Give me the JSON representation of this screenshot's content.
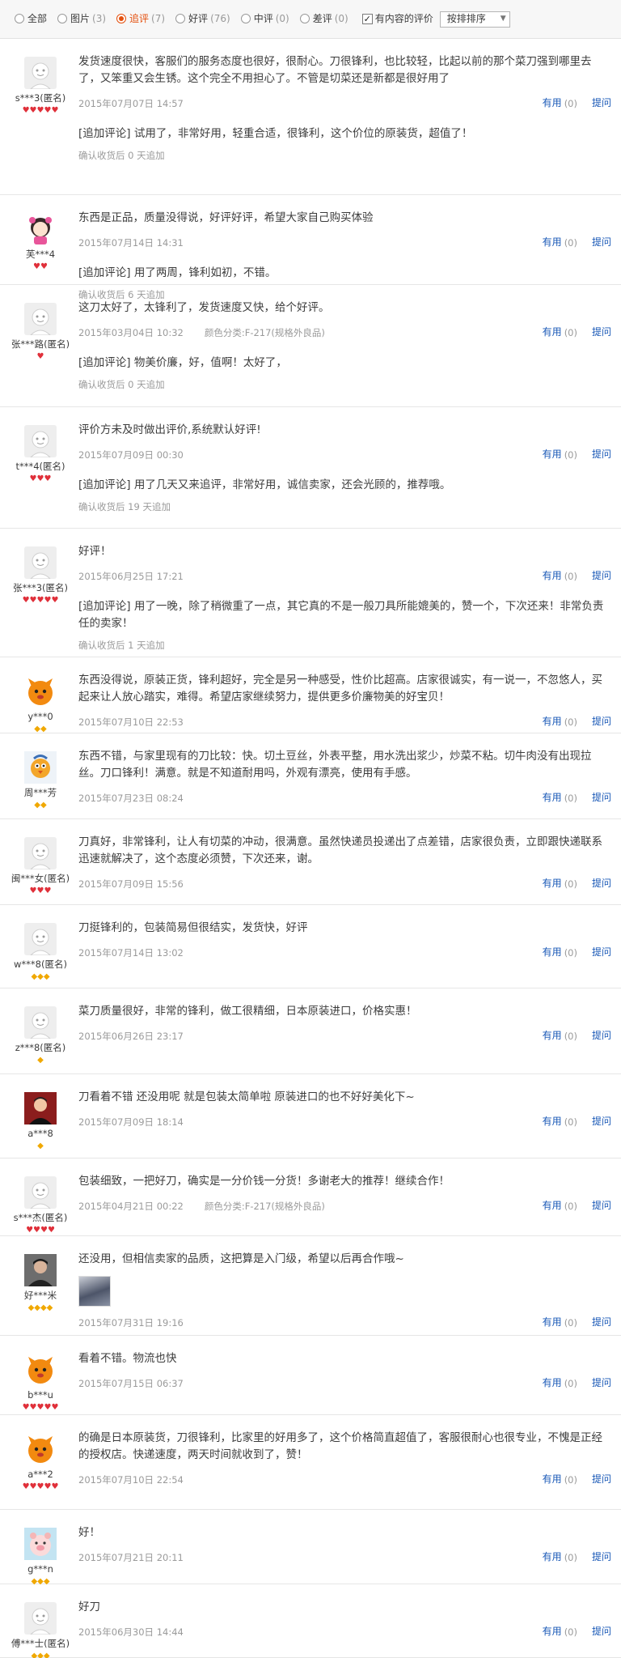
{
  "filter": {
    "options": [
      {
        "label": "全部",
        "count": ""
      },
      {
        "label": "图片",
        "count": "(3)"
      },
      {
        "label": "追评",
        "count": "(7)"
      },
      {
        "label": "好评",
        "count": "(76)"
      },
      {
        "label": "中评",
        "count": "(0)"
      },
      {
        "label": "差评",
        "count": "(0)"
      }
    ],
    "has_content_label": "有内容的评价",
    "sort_label": "按排排序"
  },
  "reviews": [
    {
      "user": "s***3(匿名)",
      "rank": "♥♥♥♥♥",
      "content": "发货速度很快，客服们的服务态度也很好，很耐心。刀很锋利，也比较轻，比起以前的那个菜刀强到哪里去了，又笨重又会生锈。这个完全不用担心了。不管是切菜还是新都是很好用了",
      "date": "2015年07月07日 14:57",
      "sku": "",
      "useful": "有用",
      "count": "(0)",
      "reply": "提问",
      "append": "[追加评论] 试用了，非常好用，轻重合适，很锋利，这个价位的原装货，超值了！",
      "confirm": "确认收货后 0 天追加"
    },
    {
      "user": "芙***4",
      "rank": "♥♥",
      "content": "东西是正品，质量没得说，好评好评，希望大家自己购买体验",
      "date": "2015年07月14日 14:31",
      "sku": "",
      "useful": "有用",
      "count": "(0)",
      "reply": "提问",
      "append": "[追加评论] 用了两周，锋利如初，不错。",
      "confirm": "确认收货后 6 天追加"
    },
    {
      "user": "张***路(匿名)",
      "rank": "♥",
      "content": "这刀太好了，太锋利了，发货速度又快，给个好评。",
      "date": "2015年03月04日 10:32",
      "sku": "颜色分类:F-217(规格外良品)",
      "useful": "有用",
      "count": "(0)",
      "reply": "提问",
      "append": "[追加评论] 物美价廉，好，值啊！太好了，",
      "confirm": "确认收货后 0 天追加"
    },
    {
      "user": "t***4(匿名)",
      "rank": "♥♥♥",
      "content": "评价方未及时做出评价,系统默认好评!",
      "date": "2015年07月09日 00:30",
      "sku": "",
      "useful": "有用",
      "count": "(0)",
      "reply": "提问",
      "append": "[追加评论] 用了几天又来追评，非常好用，诚信卖家，还会光顾的，推荐哦。",
      "confirm": "确认收货后 19 天追加"
    },
    {
      "user": "张***3(匿名)",
      "rank": "♥♥♥♥♥",
      "content": "好评！",
      "date": "2015年06月25日 17:21",
      "sku": "",
      "useful": "有用",
      "count": "(0)",
      "reply": "提问",
      "append": "[追加评论] 用了一晚，除了稍微重了一点，其它真的不是一般刀具所能媲美的，赞一个，下次还来！非常负责任的卖家！",
      "confirm": "确认收货后 1 天追加"
    },
    {
      "user": "y***0",
      "rank": "◆◆",
      "content": "东西没得说，原装正货，锋利超好，完全是另一种感受，性价比超高。店家很诚实，有一说一，不忽悠人，买起来让人放心踏实，难得。希望店家继续努力，提供更多价廉物美的好宝贝！",
      "date": "2015年07月10日 22:53",
      "sku": "",
      "useful": "有用",
      "count": "(0)",
      "reply": "提问",
      "append": "",
      "confirm": ""
    },
    {
      "user": "周***芳",
      "rank": "◆◆",
      "content": "东西不错，与家里现有的刀比较：快。切土豆丝，外表平整，用水洗出浆少，炒菜不粘。切牛肉没有出现拉丝。刀口锋利！满意。就是不知道耐用吗，外观有漂亮，使用有手感。",
      "date": "2015年07月23日 08:24",
      "sku": "",
      "useful": "有用",
      "count": "(0)",
      "reply": "提问",
      "append": "",
      "confirm": ""
    },
    {
      "user": "闽***女(匿名)",
      "rank": "♥♥♥",
      "content": "刀真好，非常锋利，让人有切菜的冲动，很满意。虽然快递员投递出了点差错，店家很负责，立即跟快递联系迅速就解决了，这个态度必须赞，下次还来，谢。",
      "date": "2015年07月09日 15:56",
      "sku": "",
      "useful": "有用",
      "count": "(0)",
      "reply": "提问",
      "append": "",
      "confirm": ""
    },
    {
      "user": "w***8(匿名)",
      "rank": "◆◆◆",
      "content": "刀挺锋利的，包装简易但很结实，发货快，好评",
      "date": "2015年07月14日 13:02",
      "sku": "",
      "useful": "有用",
      "count": "(0)",
      "reply": "提问",
      "append": "",
      "confirm": ""
    },
    {
      "user": "z***8(匿名)",
      "rank": "◆",
      "content": "菜刀质量很好，非常的锋利，做工很精细，日本原装进口，价格实惠！",
      "date": "2015年06月26日 23:17",
      "sku": "",
      "useful": "有用",
      "count": "(0)",
      "reply": "提问",
      "append": "",
      "confirm": ""
    },
    {
      "user": "a***8",
      "rank": "◆",
      "content": "刀看着不错 还没用呢 就是包装太简单啦 原装进口的也不好好美化下~",
      "date": "2015年07月09日 18:14",
      "sku": "",
      "useful": "有用",
      "count": "(0)",
      "reply": "提问",
      "append": "",
      "confirm": ""
    },
    {
      "user": "s***杰(匿名)",
      "rank": "♥♥♥♥",
      "content": "包装细致，一把好刀，确实是一分价钱一分货！多谢老大的推荐！继续合作！",
      "date": "2015年04月21日 00:22",
      "sku": "颜色分类:F-217(规格外良品)",
      "useful": "有用",
      "count": "(0)",
      "reply": "提问",
      "append": "",
      "confirm": ""
    },
    {
      "user": "好***米",
      "rank": "◆◆◆◆",
      "content": "还没用，但相信卖家的品质，这把算是入门级，希望以后再合作哦~",
      "date": "2015年07月31日 19:16",
      "sku": "",
      "useful": "有用",
      "count": "(0)",
      "reply": "提问",
      "append": "",
      "confirm": ""
    },
    {
      "user": "b***u",
      "rank": "♥♥♥♥♥",
      "content": "看着不错。物流也快",
      "date": "2015年07月15日 06:37",
      "sku": "",
      "useful": "有用",
      "count": "(0)",
      "reply": "提问",
      "append": "",
      "confirm": ""
    },
    {
      "user": "a***2",
      "rank": "♥♥♥♥♥",
      "content": "的确是日本原装货，刀很锋利，比家里的好用多了，这个价格简直超值了，客服很耐心也很专业，不愧是正经的授权店。快递速度，两天时间就收到了，赞！",
      "date": "2015年07月10日 22:54",
      "sku": "",
      "useful": "有用",
      "count": "(0)",
      "reply": "提问",
      "append": "",
      "confirm": ""
    },
    {
      "user": "g***n",
      "rank": "◆◆◆",
      "content": "好！",
      "date": "2015年07月21日 20:11",
      "sku": "",
      "useful": "有用",
      "count": "(0)",
      "reply": "提问",
      "append": "",
      "confirm": ""
    },
    {
      "user": "傅***士(匿名)",
      "rank": "◆◆◆",
      "content": "好刀",
      "date": "2015年06月30日 14:44",
      "sku": "",
      "useful": "有用",
      "count": "(0)",
      "reply": "提问",
      "append": "",
      "confirm": ""
    }
  ]
}
